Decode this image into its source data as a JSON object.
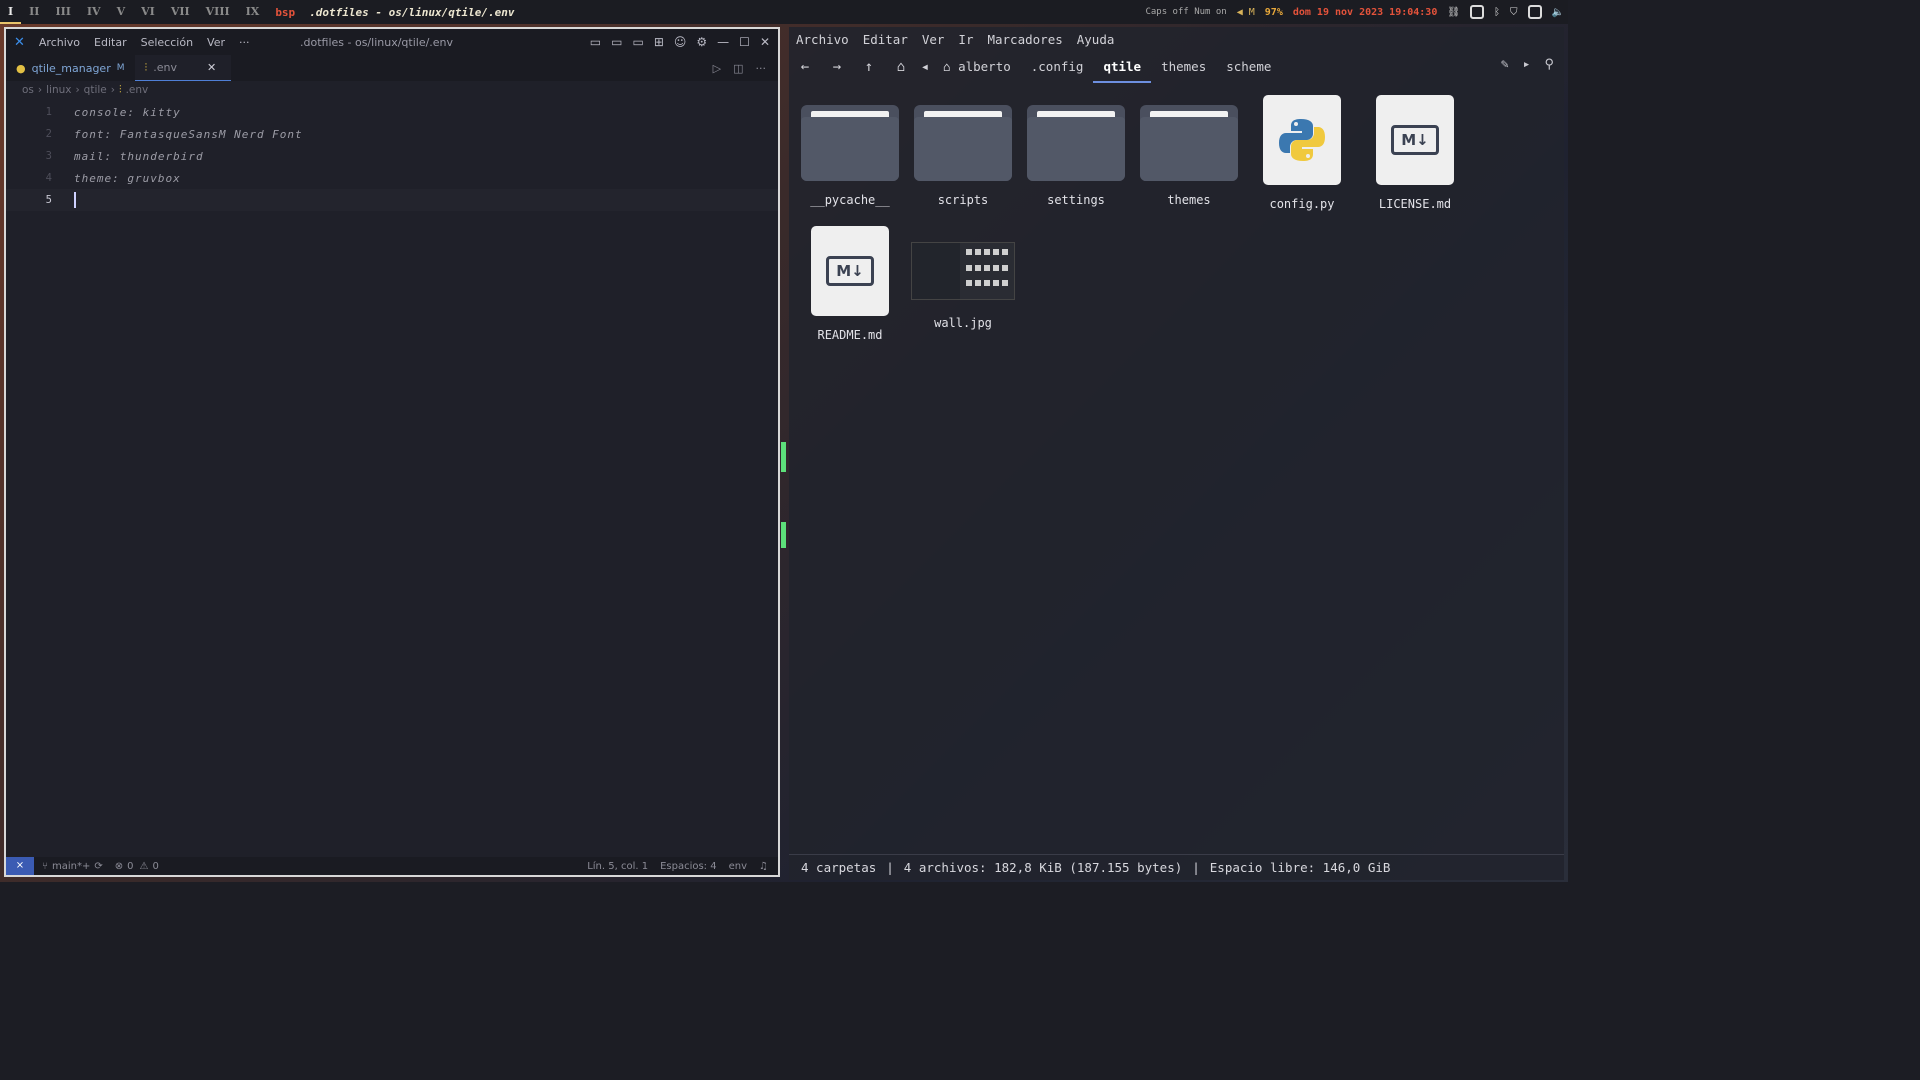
{
  "topbar": {
    "workspaces": [
      "I",
      "II",
      "III",
      "IV",
      "V",
      "VI",
      "VII",
      "VIII",
      "IX"
    ],
    "active_workspace": "I",
    "layout": "bsp",
    "window_title": ".dotfiles - os/linux/qtile/.env",
    "caps": "Caps off Num on",
    "volume": "◀ M",
    "battery": "97%",
    "datetime": "dom 19 nov 2023 19:04:30"
  },
  "editor": {
    "menu": [
      "Archivo",
      "Editar",
      "Selección",
      "Ver",
      "···"
    ],
    "title": ".dotfiles - os/linux/qtile/.env",
    "tabs": [
      {
        "label": "qtile_manager",
        "badge": "M"
      },
      {
        "label": ".env",
        "close": "✕"
      }
    ],
    "breadcrumb": [
      "os",
      "linux",
      "qtile",
      ".env"
    ],
    "lines": [
      {
        "n": "1",
        "text": "console: kitty"
      },
      {
        "n": "2",
        "text": "font: FantasqueSansM Nerd Font"
      },
      {
        "n": "3",
        "text": "mail: thunderbird"
      },
      {
        "n": "4",
        "text": "theme: gruvbox"
      },
      {
        "n": "5",
        "text": ""
      }
    ],
    "status": {
      "branch": "main*+",
      "errors": "0",
      "warnings": "0",
      "position": "Lín. 5, col. 1",
      "spaces": "Espacios: 4",
      "lang": "env"
    }
  },
  "filemanager": {
    "menu": [
      "Archivo",
      "Editar",
      "Ver",
      "Ir",
      "Marcadores",
      "Ayuda"
    ],
    "path": [
      "alberto",
      ".config",
      "qtile",
      "themes",
      "scheme"
    ],
    "active_crumb": "qtile",
    "items": [
      {
        "name": "__pycache__",
        "type": "folder"
      },
      {
        "name": "scripts",
        "type": "folder"
      },
      {
        "name": "settings",
        "type": "folder"
      },
      {
        "name": "themes",
        "type": "folder"
      },
      {
        "name": "config.py",
        "type": "python"
      },
      {
        "name": "LICENSE.md",
        "type": "markdown"
      },
      {
        "name": "README.md",
        "type": "markdown"
      },
      {
        "name": "wall.jpg",
        "type": "image"
      }
    ],
    "status": {
      "folders": "4 carpetas",
      "files": "4 archivos: 182,8 KiB (187.155 bytes)",
      "free": "Espacio libre: 146,0 GiB"
    }
  },
  "colors": {
    "accent": "#6d8fe0",
    "layout": "#e5533b",
    "battery": "#e8a83a"
  }
}
